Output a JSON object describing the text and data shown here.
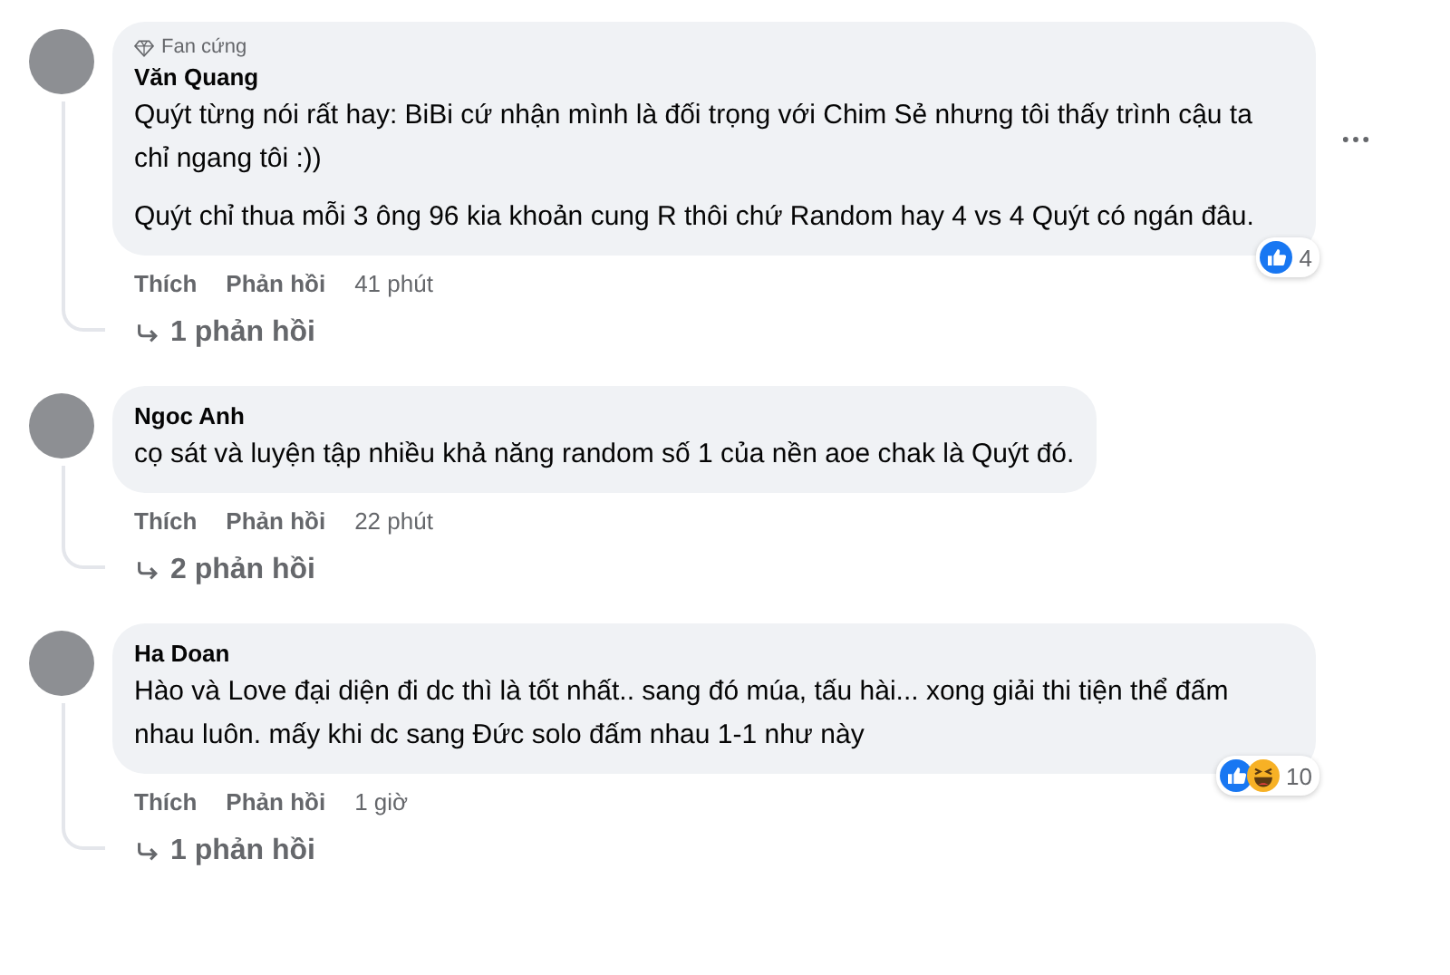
{
  "comments": [
    {
      "badge": "Fan cứng",
      "author": "Văn Quang",
      "paragraphs": [
        "Quýt từng nói rất hay: BiBi cứ nhận mình là đối trọng với Chim Sẻ nhưng tôi thấy trình cậu ta chỉ ngang tôi :))",
        "Quýt chỉ thua mỗi 3 ông 96 kia khoản cung R thôi chứ Random hay 4 vs 4 Quýt có ngán đâu."
      ],
      "reactions": [
        {
          "kind": "like"
        }
      ],
      "reaction_count": "4",
      "like_label": "Thích",
      "reply_label": "Phản hồi",
      "time": "41 phút",
      "replies": "1 phản hồi",
      "more_menu": true
    },
    {
      "author": "Ngoc Anh",
      "paragraphs": [
        "cọ sát và luyện tập nhiều khả năng random số 1 của nền aoe chak là Quýt đó."
      ],
      "like_label": "Thích",
      "reply_label": "Phản hồi",
      "time": "22 phút",
      "replies": "2 phản hồi",
      "more_menu": false
    },
    {
      "author": "Ha Doan",
      "paragraphs": [
        "Hào và Love đại diện đi dc thì là tốt nhất.. sang đó múa, tấu hài... xong giải thi tiện thể đấm nhau luôn. mấy khi dc sang Đức solo đấm nhau 1-1 như này"
      ],
      "reactions": [
        {
          "kind": "like"
        },
        {
          "kind": "haha"
        }
      ],
      "reaction_count": "10",
      "like_label": "Thích",
      "reply_label": "Phản hồi",
      "time": "1 giờ",
      "replies": "1 phản hồi",
      "more_menu": false
    }
  ]
}
